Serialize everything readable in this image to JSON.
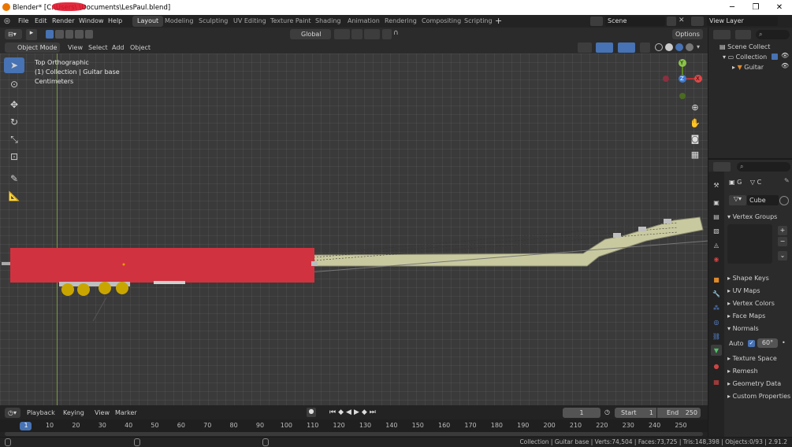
{
  "window": {
    "title": "Blender* [C:\\Users\\    \\Documents\\LesPaul.blend]",
    "minimize": "─",
    "maximize": "❐",
    "close": "✕"
  },
  "menu": {
    "items": [
      "File",
      "Edit",
      "Render",
      "Window",
      "Help"
    ],
    "workspaces": [
      "Layout",
      "Modeling",
      "Sculpting",
      "UV Editing",
      "Texture Paint",
      "Shading",
      "Animation",
      "Rendering",
      "Compositing",
      "Scripting"
    ],
    "add_tab": "+",
    "scene": "Scene",
    "view_layer": "View Layer"
  },
  "toolheader": {
    "orientation": "Global",
    "options": "Options"
  },
  "viewport_header": {
    "mode": "Object Mode",
    "menus": [
      "View",
      "Select",
      "Add",
      "Object"
    ]
  },
  "viewport": {
    "view_name": "Top Orthographic",
    "collection_info": "(1) Collection | Guitar base",
    "units": "Centimeters",
    "gizmo": {
      "y": "Y",
      "z": "Z",
      "x": "X"
    },
    "accent": "#d11f3a"
  },
  "outliner": {
    "items": [
      "Scene Collect",
      "Collection",
      "Guitar"
    ]
  },
  "properties": {
    "data_tab_labels": [
      "G",
      "C"
    ],
    "mesh_name": "Cube",
    "sections": {
      "vertex_groups": "Vertex Groups",
      "shape_keys": "Shape Keys",
      "uv_maps": "UV Maps",
      "vertex_colors": "Vertex Colors",
      "face_maps": "Face Maps",
      "normals": "Normals",
      "auto_smooth": "Auto",
      "auto_smooth_angle": "60°",
      "texture_space": "Texture Space",
      "remesh": "Remesh",
      "geometry_data": "Geometry Data",
      "custom_properties": "Custom Properties"
    }
  },
  "timeline": {
    "menus": [
      "Playback",
      "Keying",
      "View",
      "Marker"
    ],
    "current_frame": "1",
    "start_label": "Start",
    "start": "1",
    "end_label": "End",
    "end": "250",
    "ticks": [
      "1",
      "10",
      "20",
      "30",
      "40",
      "50",
      "60",
      "70",
      "80",
      "90",
      "100",
      "110",
      "120",
      "130",
      "140",
      "150",
      "160",
      "170",
      "180",
      "190",
      "200",
      "210",
      "220",
      "230",
      "240",
      "250"
    ]
  },
  "status": {
    "text": "Collection | Guitar base | Verts:74,504 | Faces:73,725 | Tris:148,398 | Objects:0/93 | 2.91.2"
  }
}
